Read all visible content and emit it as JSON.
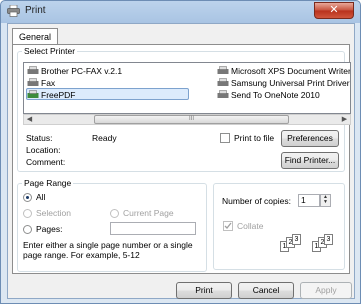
{
  "window": {
    "title": "Print",
    "close_label": "✕"
  },
  "tabs": [
    {
      "label": "General"
    }
  ],
  "select_printer": {
    "legend": "Select Printer",
    "printers": [
      {
        "name": "Brother PC-FAX v.2.1"
      },
      {
        "name": "Fax"
      },
      {
        "name": "FreePDF"
      },
      {
        "name": "Microsoft XPS Document Writer"
      },
      {
        "name": "Samsung Universal Print Driver (c"
      },
      {
        "name": "Send To OneNote 2010"
      }
    ],
    "selected": "FreePDF",
    "scroll_thumb": "III",
    "status_label": "Status:",
    "status_value": "Ready",
    "location_label": "Location:",
    "comment_label": "Comment:",
    "print_to_file_label": "Print to file",
    "preferences_label": "Preferences",
    "find_printer_label": "Find Printer..."
  },
  "page_range": {
    "legend": "Page Range",
    "all_label": "All",
    "selection_label": "Selection",
    "current_page_label": "Current Page",
    "pages_label": "Pages:",
    "pages_value": "",
    "hint": "Enter either a single page number or a single page range. For example, 5-12"
  },
  "copies": {
    "label": "Number of copies:",
    "value": "1",
    "collate_label": "Collate"
  },
  "footer": {
    "print_label": "Print",
    "cancel_label": "Cancel",
    "apply_label": "Apply"
  },
  "colors": {
    "selection_bg": "#dcebfc",
    "close_red": "#c7503b"
  }
}
